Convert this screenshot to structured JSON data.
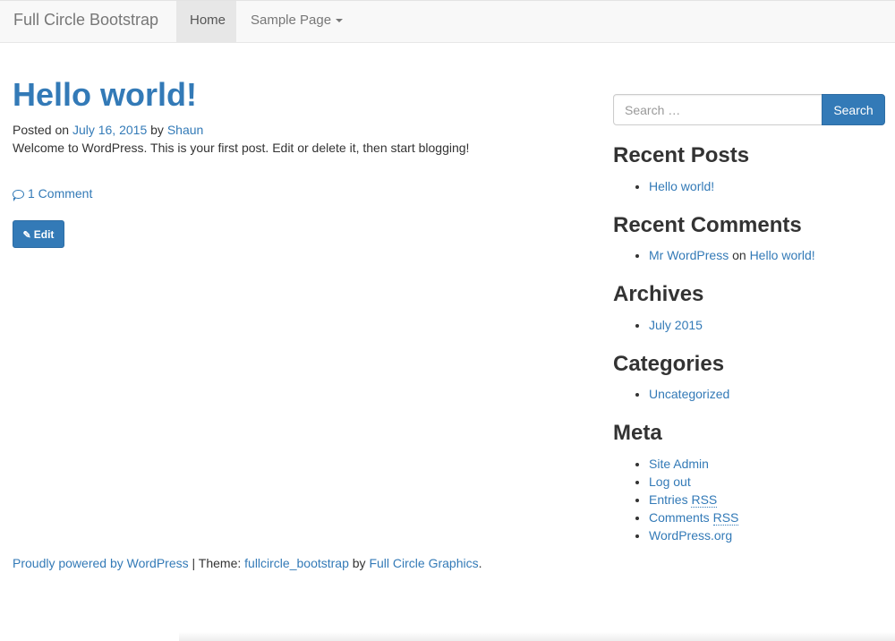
{
  "navbar": {
    "brand": "Full Circle Bootstrap",
    "items": [
      {
        "label": "Home",
        "active": true
      },
      {
        "label": "Sample Page",
        "dropdown": true
      }
    ]
  },
  "post": {
    "title": "Hello world!",
    "posted_on_label": "Posted on",
    "date": "July 16, 2015",
    "by_label": "by",
    "author": "Shaun",
    "body": "Welcome to WordPress. This is your first post. Edit or delete it, then start blogging!",
    "comments_link": "1 Comment",
    "edit_label": "Edit"
  },
  "sidebar": {
    "search": {
      "placeholder": "Search …",
      "button_label": "Search"
    },
    "recent_posts": {
      "title": "Recent Posts",
      "items": [
        "Hello world!"
      ]
    },
    "recent_comments": {
      "title": "Recent Comments",
      "items": [
        {
          "author": "Mr WordPress",
          "on_label": "on",
          "post": "Hello world!"
        }
      ]
    },
    "archives": {
      "title": "Archives",
      "items": [
        "July 2015"
      ]
    },
    "categories": {
      "title": "Categories",
      "items": [
        "Uncategorized"
      ]
    },
    "meta": {
      "title": "Meta",
      "site_admin": "Site Admin",
      "log_out": "Log out",
      "entries_prefix": "Entries",
      "comments_prefix": "Comments",
      "rss": "RSS",
      "wordpress_org": "WordPress.org"
    }
  },
  "footer": {
    "powered": "Proudly powered by WordPress",
    "separator": "|",
    "theme_label": "Theme:",
    "theme_name": "fullcircle_bootstrap",
    "by_label": "by",
    "theme_author": "Full Circle Graphics",
    "end": "."
  },
  "colors": {
    "link": "#337ab7",
    "button": "#337ab7",
    "navbar_bg": "#f8f8f8",
    "nav_active_bg": "#e7e7e7"
  },
  "icons": {
    "comment": "comment-icon",
    "edit": "pencil-icon",
    "dropdown": "caret-icon"
  }
}
